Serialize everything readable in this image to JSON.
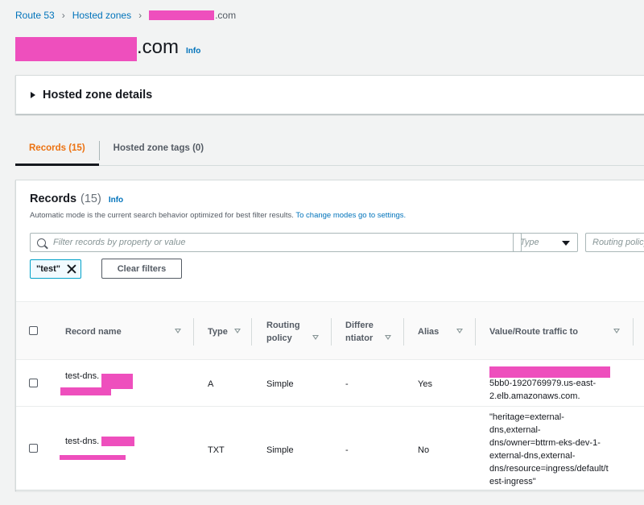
{
  "breadcrumb": {
    "root": "Route 53",
    "hosted_zones": "Hosted zones",
    "current_suffix": ".com"
  },
  "page": {
    "title_suffix": ".com",
    "info": "Info"
  },
  "details": {
    "heading": "Hosted zone details"
  },
  "tabs": [
    {
      "label": "Records (15)"
    },
    {
      "label": "Hosted zone tags (0)"
    }
  ],
  "records": {
    "title": "Records",
    "count": "(15)",
    "info": "Info",
    "description": "Automatic mode is the current search behavior optimized for best filter results.",
    "description_link": "To change modes go to settings.",
    "search_placeholder": "Filter records by property or value",
    "type_placeholder": "Type",
    "routing_placeholder": "Routing policy",
    "filter_token": "\"test\"",
    "clear_filters": "Clear filters"
  },
  "table": {
    "columns": [
      "Record name",
      "Type",
      "Routing policy",
      "Differentiator",
      "Alias",
      "Value/Route traffic to"
    ],
    "col_lines": {
      "routing": [
        "Routing",
        "policy"
      ],
      "differentiator": [
        "Differe",
        "ntiator"
      ]
    },
    "rows": [
      {
        "name": "test-dns.",
        "type": "A",
        "routing": "Simple",
        "differentiator": "-",
        "alias": "Yes",
        "value_lines": [
          "5bb0-1920769979.us-east-",
          "2.elb.amazonaws.com."
        ]
      },
      {
        "name": "test-dns.",
        "type": "TXT",
        "routing": "Simple",
        "differentiator": "-",
        "alias": "No",
        "value_lines": [
          "\"heritage=external-",
          "dns,external-",
          "dns/owner=bttrm-eks-dev-1-",
          "external-dns,external-",
          "dns/resource=ingress/default/t",
          "est-ingress\""
        ]
      }
    ]
  },
  "colors": {
    "link": "#0073bb",
    "active_tab": "#ec7211",
    "redaction": "#ee4fbd"
  }
}
